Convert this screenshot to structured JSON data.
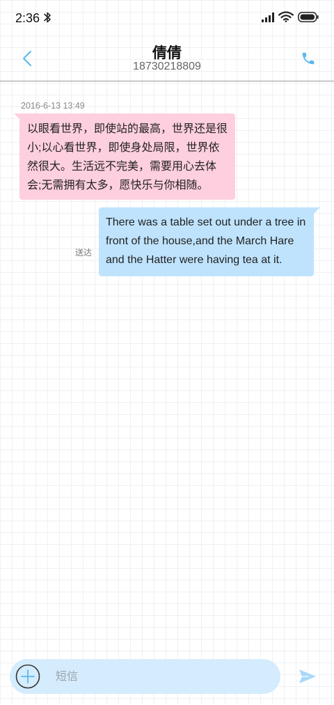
{
  "status_bar": {
    "time": "2:36",
    "icons": [
      "bluetooth-icon",
      "signal-icon",
      "wifi-icon",
      "battery-icon"
    ]
  },
  "header": {
    "contact_name": "倩倩",
    "contact_number": "18730218809",
    "back_icon": "chevron-left-icon",
    "call_icon": "phone-icon"
  },
  "conversation": {
    "timestamp": "2016-6-13 13:49",
    "messages": [
      {
        "direction": "incoming",
        "text": "以眼看世界，即使站的最高，世界还是很小;以心看世界，即使身处局限，世界依然很大。生活远不完美，需要用心去体会;无需拥有太多，愿快乐与你相随。"
      },
      {
        "direction": "outgoing",
        "text": "There was a table set out under a tree in front of the house,and the March Hare and the Hatter were having tea at it.",
        "status": "送达"
      }
    ]
  },
  "composer": {
    "placeholder": "短信",
    "value": "",
    "add_icon": "plus-circle-icon",
    "send_icon": "send-icon"
  },
  "colors": {
    "accent": "#5bb8ef",
    "incoming_bubble": "#fecfdf",
    "outgoing_bubble": "#bfe3fd",
    "input_bar": "#d4ecfd",
    "grid_line": "#eef0f3"
  }
}
